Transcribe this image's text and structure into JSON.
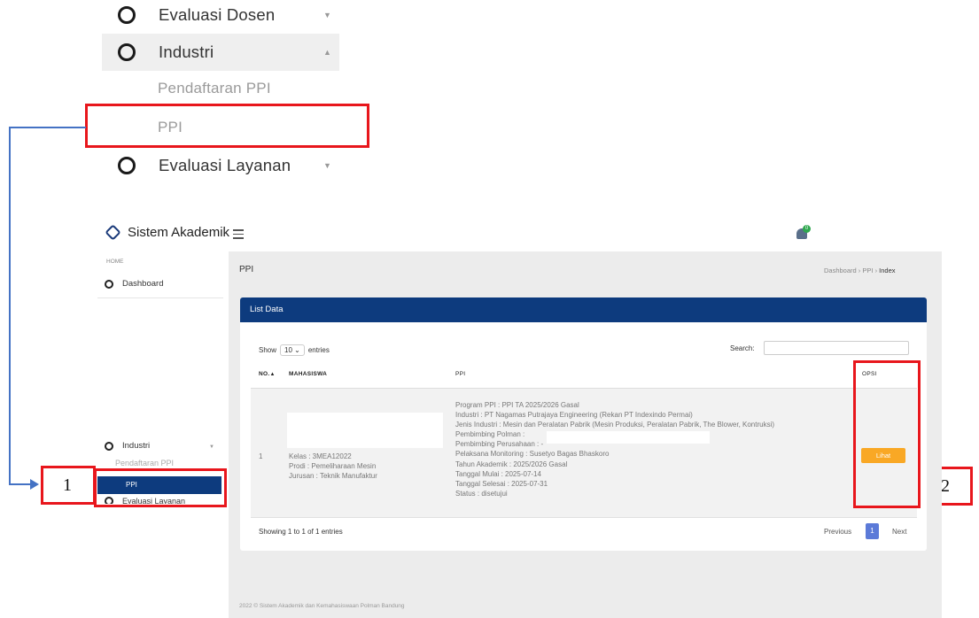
{
  "zoom_menu": {
    "items": [
      {
        "label": "Evaluasi Dosen"
      },
      {
        "label": "Industri"
      },
      {
        "label": "Evaluasi Layanan"
      }
    ],
    "subitems": [
      {
        "label": "Pendaftaran PPI"
      },
      {
        "label": "PPI"
      }
    ]
  },
  "annotations": {
    "label_1": "1",
    "label_2": "2",
    "box_color": "#e8161c",
    "arrow_color": "#4472c4"
  },
  "app": {
    "title": "Sistem Akademik",
    "notification_count": "0",
    "sidebar": {
      "home_label": "HOME",
      "dashboard": "Dashboard",
      "industri": "Industri",
      "pendaftaran": "Pendaftaran PPI",
      "ppi": "PPI",
      "evaluasi": "Evaluasi Layanan"
    },
    "page_title": "PPI",
    "breadcrumb": [
      "Dashboard",
      "PPI",
      "Index"
    ],
    "card_title": "List Data",
    "show": {
      "prefix": "Show",
      "value": "10",
      "suffix": "entries"
    },
    "search_label": "Search:",
    "columns": [
      "NO.",
      "MAHASISWA",
      "PPI",
      "OPSI"
    ],
    "row": {
      "no": "1",
      "mahasiswa": [
        "Kelas : 3MEA12022",
        "Prodi : Pemeliharaan Mesin",
        "Jurusan : Teknik Manufaktur"
      ],
      "ppi": [
        "Program PPI : PPI TA 2025/2026 Gasal",
        "Industri : PT Nagamas Putrajaya Engineering (Rekan PT Indexindo Permai)",
        "Jenis Industri : Mesin dan Peralatan Pabrik (Mesin Produksi, Peralatan Pabrik, The Blower, Kontruksi)",
        "Pembimbing Polman :",
        "Pembimbing Perusahaan : -",
        "Pelaksana Monitoring : Susetyo Bagas Bhaskoro",
        "Tahun Akademik : 2025/2026 Gasal",
        "Tanggal Mulai : 2025-07-14",
        "Tanggal Selesai : 2025-07-31",
        "Status : disetujui"
      ],
      "action": "Lihat"
    },
    "showing": "Showing 1 to 1 of 1 entries",
    "pagination": {
      "prev": "Previous",
      "current": "1",
      "next": "Next"
    },
    "footer": "2022 © Sistem Akademik dan Kemahasiswaan Polman Bandung",
    "colors": {
      "primary": "#0d3b7e",
      "action": "#f9a825",
      "page_active": "#5b7ad8"
    }
  }
}
